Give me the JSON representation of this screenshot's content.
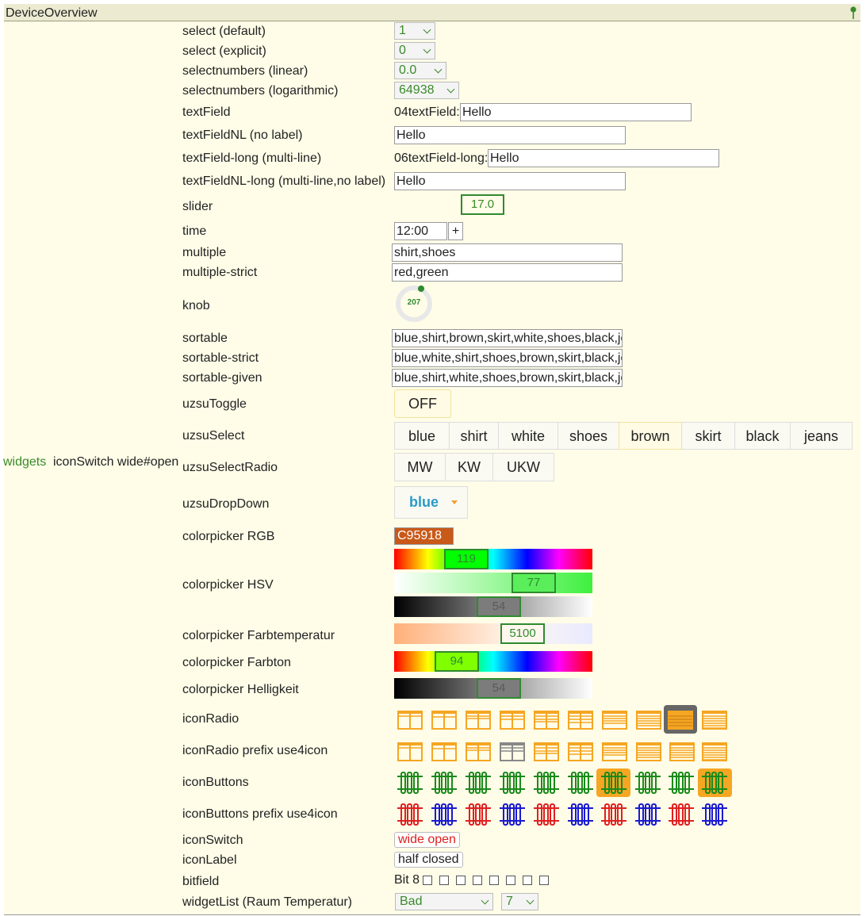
{
  "title": "DeviceOverview",
  "side": {
    "group": "widgets",
    "device": "iconSwitch wide#open"
  },
  "labels": {
    "select_default": "select (default)",
    "select_explicit": "select (explicit)",
    "selectnumbers_linear": "selectnumbers (linear)",
    "selectnumbers_log": "selectnumbers (logarithmic)",
    "textField": "textField",
    "textFieldNL": "textFieldNL (no label)",
    "textFieldLong": "textField-long (multi-line)",
    "textFieldNLLong": "textFieldNL-long (multi-line,no label)",
    "slider": "slider",
    "time": "time",
    "multiple": "multiple",
    "multipleStrict": "multiple-strict",
    "knob": "knob",
    "sortable": "sortable",
    "sortableStrict": "sortable-strict",
    "sortableGiven": "sortable-given",
    "uzsuToggle": "uzsuToggle",
    "uzsuSelect": "uzsuSelect",
    "uzsuSelectRadio": "uzsuSelectRadio",
    "uzsuDropDown": "uzsuDropDown",
    "cpRGB": "colorpicker RGB",
    "cpHSV": "colorpicker HSV",
    "cpTemp": "colorpicker Farbtemperatur",
    "cpHue": "colorpicker Farbton",
    "cpBright": "colorpicker Helligkeit",
    "iconRadio": "iconRadio",
    "iconRadioPrefix": "iconRadio prefix use4icon",
    "iconButtons": "iconButtons",
    "iconButtonsPrefix": "iconButtons prefix use4icon",
    "iconSwitch": "iconSwitch",
    "iconLabel": "iconLabel",
    "bitfield": "bitfield",
    "widgetList": "widgetList (Raum Temperatur)"
  },
  "values": {
    "select_default": "1",
    "select_explicit": "0",
    "selectnumbers_linear": "0.0",
    "selectnumbers_log": "64938",
    "textField_prefix": "04textField:",
    "textField": "Hello",
    "textFieldNL": "Hello",
    "textFieldLong_prefix": "06textField-long:",
    "textFieldLong": "Hello",
    "textFieldNLLong": "Hello",
    "slider": "17.0",
    "time": "12:00",
    "time_plus": "+",
    "multiple": "shirt,shoes",
    "multipleStrict": "red,green",
    "knob": "207",
    "sortable": "blue,shirt,brown,skirt,white,shoes,black,jeans",
    "sortableStrict": "blue,white,shirt,shoes,brown,skirt,black,jeans",
    "sortableGiven": "blue,shirt,white,shoes,brown,skirt,black,jeans",
    "uzsuToggle": "OFF",
    "uzsuSelect": [
      "blue",
      "shirt",
      "white",
      "shoes",
      "brown",
      "skirt",
      "black",
      "jeans"
    ],
    "uzsuSelectRadio": [
      "MW",
      "KW",
      "UKW"
    ],
    "uzsuDropDown": "blue",
    "cpRGB": "C95918",
    "cpRGB_color": "#c95918",
    "hsv_h": "119",
    "hsv_s": "77",
    "hsv_v": "54",
    "temp": "5100",
    "hue": "94",
    "bright": "54",
    "iconSwitch": "wide open",
    "iconLabel": "half closed",
    "bitfield_label": "Bit 8",
    "widgetList_room": "Bad",
    "widgetList_temp": "7"
  },
  "colors": {
    "accent": "#3a8a2a",
    "orange": "#f5a623",
    "red": "#e02020",
    "blue": "#1a1ad0",
    "green": "#1a8a1a",
    "switch_red": "#e02020"
  }
}
